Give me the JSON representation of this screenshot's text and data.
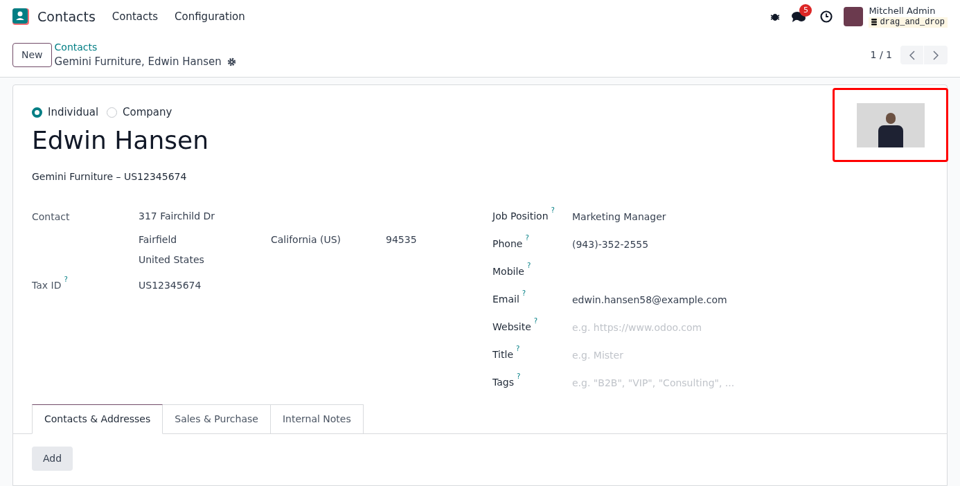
{
  "navbar": {
    "app_name": "Contacts",
    "menu": [
      "Contacts",
      "Configuration"
    ],
    "notification_count": "5",
    "user_name": "Mitchell Admin",
    "database": "drag_and_drop"
  },
  "control_panel": {
    "new_button": "New",
    "breadcrumb_parent": "Contacts",
    "breadcrumb_current": "Gemini Furniture, Edwin Hansen",
    "pager": "1 / 1"
  },
  "form": {
    "company_type": [
      {
        "label": "Individual",
        "selected": true
      },
      {
        "label": "Company",
        "selected": false
      }
    ],
    "name": "Edwin Hansen",
    "subtitle": "Gemini Furniture – US12345674",
    "address": {
      "label": "Contact",
      "street": "317 Fairchild Dr",
      "city": "Fairfield",
      "state": "California (US)",
      "zip": "94535",
      "country": "United States"
    },
    "tax_id": {
      "label": "Tax ID",
      "help": "?",
      "value": "US12345674"
    },
    "right_fields": [
      {
        "label": "Job Position",
        "help": "?",
        "value": "Marketing Manager"
      },
      {
        "label": "Phone",
        "help": "?",
        "value": "(943)-352-2555"
      },
      {
        "label": "Mobile",
        "help": "?"
      },
      {
        "label": "Email",
        "help": "?",
        "value": "edwin.hansen58@example.com"
      },
      {
        "label": "Website",
        "help": "?",
        "placeholder": "e.g. https://www.odoo.com"
      },
      {
        "label": "Title",
        "help": "?",
        "placeholder": "e.g. Mister"
      },
      {
        "label": "Tags",
        "help": "?",
        "placeholder": "e.g. \"B2B\", \"VIP\", \"Consulting\", ..."
      }
    ],
    "tabs": [
      {
        "label": "Contacts & Addresses",
        "selected": true
      },
      {
        "label": "Sales & Purchase",
        "selected": false
      },
      {
        "label": "Internal Notes",
        "selected": false
      }
    ],
    "add_button": "Add"
  }
}
